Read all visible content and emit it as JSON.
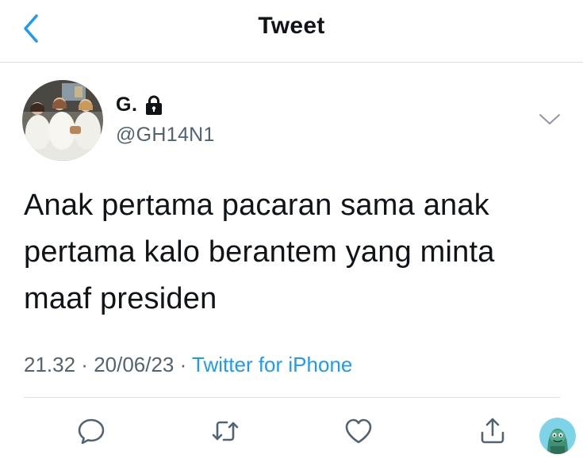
{
  "header": {
    "title": "Tweet",
    "back_icon": "chevron-left-icon"
  },
  "author": {
    "display_name": "G.",
    "handle": "@GH14N1",
    "protected_icon": "lock-icon"
  },
  "tweet": {
    "text": "Anak pertama pacaran sama anak pertama kalo berantem yang minta maaf presiden",
    "time": "21.32",
    "separator": " · ",
    "date": "20/06/23",
    "source": "Twitter for iPhone"
  },
  "actions": [
    "reply-icon",
    "retweet-icon",
    "like-icon",
    "share-icon"
  ],
  "colors": {
    "accent": "#1d9bf0",
    "secondary_text": "#536471",
    "divider": "#dcdfe2",
    "action_icon": "#536471"
  }
}
